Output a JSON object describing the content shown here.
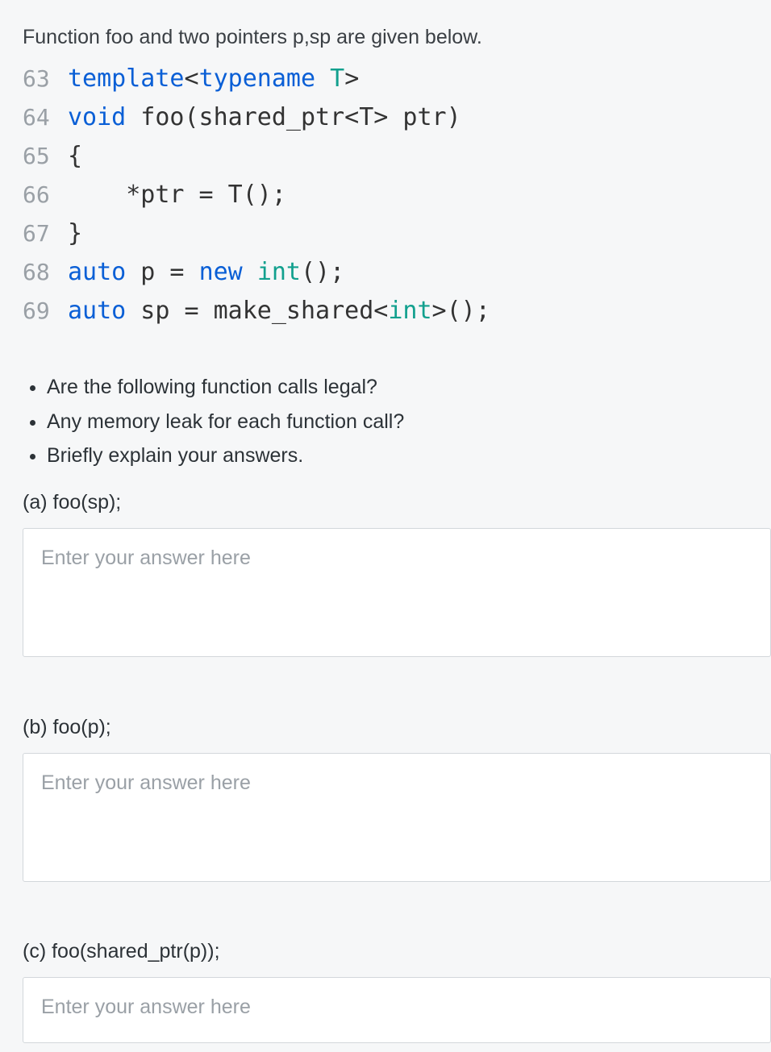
{
  "intro": "Function foo and two pointers p,sp are given below.",
  "code": {
    "lines": [
      {
        "num": "63",
        "tokens": [
          {
            "t": "template",
            "c": "kw"
          },
          {
            "t": "<",
            "c": "op"
          },
          {
            "t": "typename",
            "c": "kw"
          },
          {
            "t": " T",
            "c": "tp"
          },
          {
            "t": ">",
            "c": "op"
          }
        ]
      },
      {
        "num": "64",
        "tokens": [
          {
            "t": "void",
            "c": "kw"
          },
          {
            "t": " foo(shared_ptr<T> ptr)",
            "c": "id"
          }
        ]
      },
      {
        "num": "65",
        "tokens": [
          {
            "t": "{",
            "c": "op"
          }
        ]
      },
      {
        "num": "66",
        "tokens": [
          {
            "t": "    *ptr = T();",
            "c": "id"
          }
        ]
      },
      {
        "num": "67",
        "tokens": [
          {
            "t": "}",
            "c": "op"
          }
        ]
      },
      {
        "num": "68",
        "tokens": [
          {
            "t": "auto",
            "c": "kw"
          },
          {
            "t": " p = ",
            "c": "id"
          },
          {
            "t": "new",
            "c": "kw"
          },
          {
            "t": " ",
            "c": "id"
          },
          {
            "t": "int",
            "c": "tp"
          },
          {
            "t": "();",
            "c": "id"
          }
        ]
      },
      {
        "num": "69",
        "tokens": [
          {
            "t": "auto",
            "c": "kw"
          },
          {
            "t": " sp = make_shared<",
            "c": "id"
          },
          {
            "t": "int",
            "c": "tp"
          },
          {
            "t": ">();",
            "c": "id"
          }
        ]
      }
    ]
  },
  "bullets": [
    "Are the following function calls legal?",
    "Any memory leak for each function call?",
    "Briefly explain your answers."
  ],
  "parts": [
    {
      "label": "(a) foo(sp);",
      "placeholder": "Enter your answer here"
    },
    {
      "label": "(b) foo(p);",
      "placeholder": "Enter your answer here"
    },
    {
      "label": "(c) foo(shared_ptr(p));",
      "placeholder": "Enter your answer here"
    }
  ]
}
